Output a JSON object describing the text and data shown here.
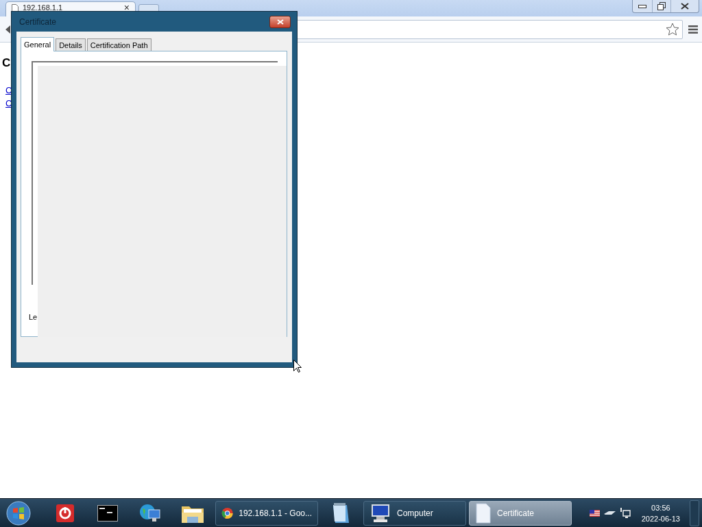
{
  "browser": {
    "tabs": [
      {
        "title": "192.168.1.1",
        "close": "×",
        "selected": true
      }
    ],
    "page": {
      "heading": "C",
      "links": [
        "C",
        "C"
      ]
    }
  },
  "dialog": {
    "title": "Certificate",
    "tabs": [
      {
        "label": "General",
        "selected": true
      },
      {
        "label": "Details",
        "selected": false
      },
      {
        "label": "Certification Path",
        "selected": false
      }
    ],
    "partial_label": "Le"
  },
  "taskbar": {
    "items": [
      {
        "kind": "power"
      },
      {
        "kind": "console"
      },
      {
        "kind": "network"
      },
      {
        "kind": "folder"
      },
      {
        "kind": "browser",
        "label": "192.168.1.1 - Goo...",
        "active": false
      },
      {
        "kind": "notepad"
      },
      {
        "kind": "computer",
        "label": "Computer",
        "active": false
      },
      {
        "kind": "document",
        "label": "Certificate",
        "active": true
      }
    ],
    "clock": {
      "time": "03:56",
      "date": "2022-06-13"
    }
  }
}
